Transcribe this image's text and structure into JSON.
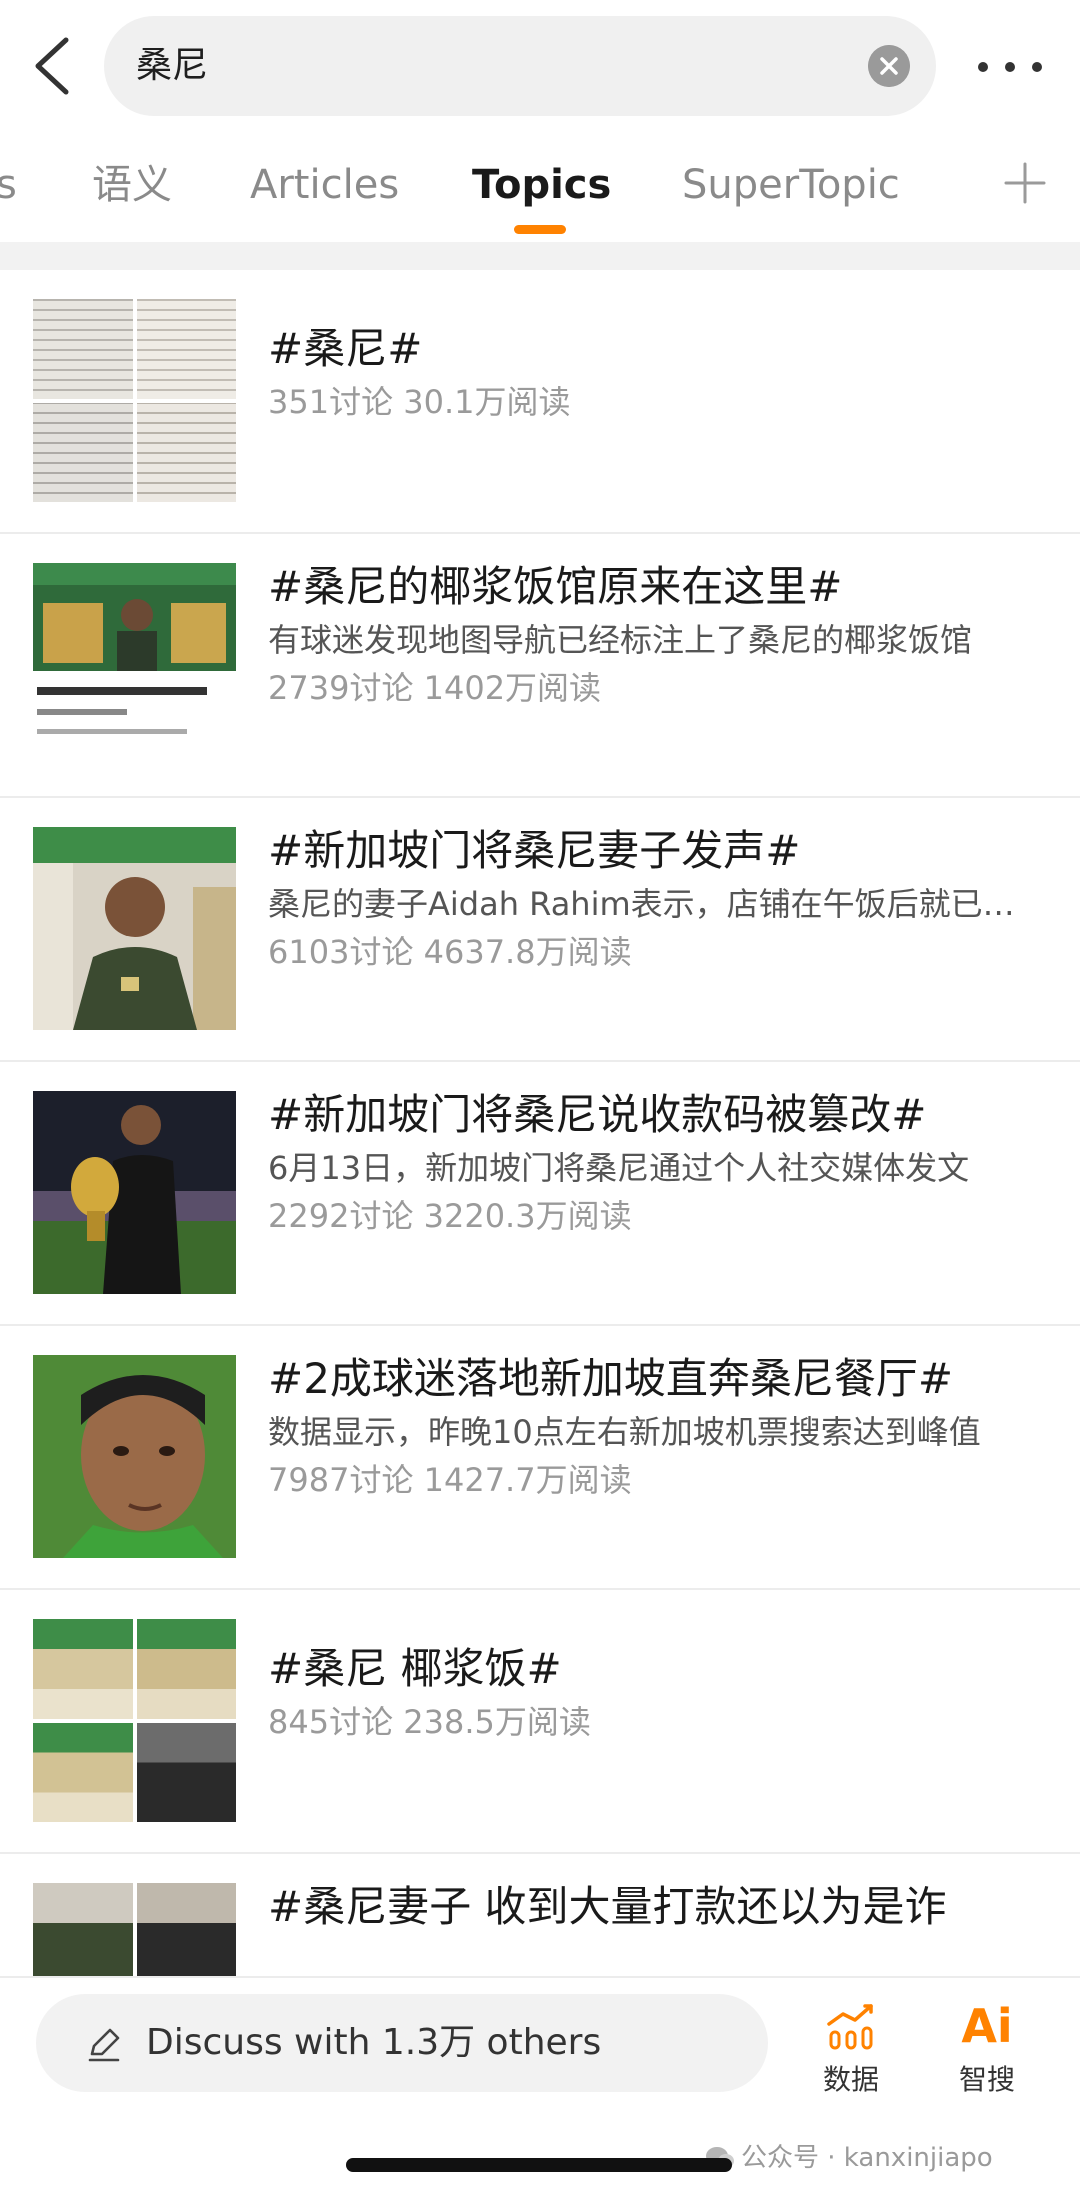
{
  "header": {
    "search_query": "桑尼",
    "back_icon": "chevron-left-icon",
    "clear_icon": "close-circle-icon",
    "more_icon": "more-horizontal-icon"
  },
  "tabs": {
    "items": [
      {
        "label": "s",
        "active": false
      },
      {
        "label": "语义",
        "active": false
      },
      {
        "label": "Articles",
        "active": false
      },
      {
        "label": "Topics",
        "active": true
      },
      {
        "label": "SuperTopic",
        "active": false
      }
    ],
    "add_icon": "plus-icon",
    "accent_color": "#ff8200"
  },
  "results": [
    {
      "title": "#桑尼#",
      "desc": "",
      "stats": "351讨论 30.1万阅读"
    },
    {
      "title": "#桑尼的椰浆饭馆原来在这里#",
      "desc": "有球迷发现地图导航已经标注上了桑尼的椰浆饭馆",
      "stats": "2739讨论 1402万阅读"
    },
    {
      "title": "#新加坡门将桑尼妻子发声#",
      "desc": "桑尼的妻子Aidah Rahim表示，店铺在午饭后就已售罄",
      "stats": "6103讨论 4637.8万阅读"
    },
    {
      "title": "#新加坡门将桑尼说收款码被篡改#",
      "desc": "6月13日，新加坡门将桑尼通过个人社交媒体发文",
      "stats": "2292讨论 3220.3万阅读"
    },
    {
      "title": "#2成球迷落地新加坡直奔桑尼餐厅#",
      "desc": "数据显示，昨晚10点左右新加坡机票搜索达到峰值",
      "stats": "7987讨论 1427.7万阅读"
    },
    {
      "title": "#桑尼 椰浆饭#",
      "desc": "",
      "stats": "845讨论 238.5万阅读"
    },
    {
      "title": "#桑尼妻子 收到大量打款还以为是诈",
      "desc": "",
      "stats": ""
    }
  ],
  "bottom_bar": {
    "discuss_label": "Discuss with 1.3万 others",
    "discuss_icon": "edit-pencil-icon",
    "data_label": "数据",
    "data_icon": "bar-chart-icon",
    "ai_label": "智搜",
    "ai_icon": "ai-search-icon",
    "ai_glyph": "Ai"
  },
  "watermark": {
    "text": "公众号 · kanxinjiapo",
    "icon": "wechat-icon"
  }
}
